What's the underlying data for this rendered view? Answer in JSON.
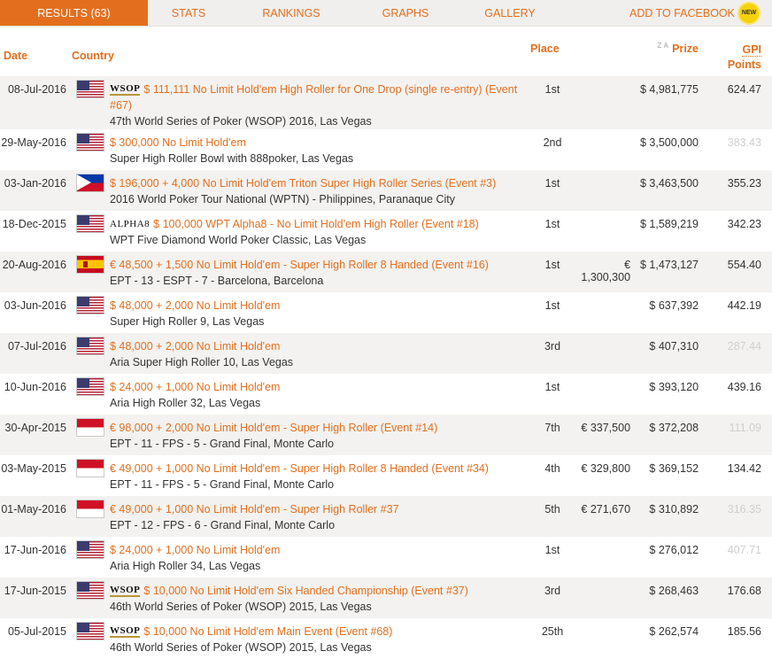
{
  "tabs": [
    {
      "label": "RESULTS (63)",
      "active": true
    },
    {
      "label": "STATS"
    },
    {
      "label": "RANKINGS"
    },
    {
      "label": "GRAPHS"
    },
    {
      "label": "GALLERY"
    },
    {
      "label": "ADD TO FACEBOOK",
      "badge": "NEW"
    }
  ],
  "columns": {
    "date": "Date",
    "country": "Country",
    "place": "Place",
    "prize": "Prize",
    "gpi_line1": "GPI",
    "gpi_line2": "Points",
    "sort_glyph": "Z A"
  },
  "rows": [
    {
      "date": "08-Jul-2016",
      "flag": "us",
      "brand": "WSOP",
      "title": "$ 111,111 No Limit Hold'em High Roller for One Drop (single re-entry) (Event #67)",
      "subtitle": "47th World Series of Poker (WSOP) 2016, Las Vegas",
      "place": "1st",
      "local_prize": "",
      "prize": "$ 4,981,775",
      "gpi": "624.47",
      "gpi_muted": false
    },
    {
      "date": "29-May-2016",
      "flag": "us",
      "brand": "",
      "title": "$ 300,000 No Limit Hold'em",
      "subtitle": "Super High Roller Bowl with 888poker, Las Vegas",
      "place": "2nd",
      "local_prize": "",
      "prize": "$ 3,500,000",
      "gpi": "383.43",
      "gpi_muted": true
    },
    {
      "date": "03-Jan-2016",
      "flag": "ph",
      "brand": "",
      "title": "$ 196,000 + 4,000 No Limit Hold'em Triton Super High Roller Series (Event #3)",
      "subtitle": "2016 World Poker Tour National (WPTN) - Philippines, Paranaque City",
      "place": "1st",
      "local_prize": "",
      "prize": "$ 3,463,500",
      "gpi": "355.23",
      "gpi_muted": false
    },
    {
      "date": "18-Dec-2015",
      "flag": "us",
      "brand": "ALPHA8",
      "title": "$ 100,000 WPT Alpha8 - No Limit Hold'em High Roller (Event #18)",
      "subtitle": "WPT Five Diamond World Poker Classic, Las Vegas",
      "place": "1st",
      "local_prize": "",
      "prize": "$ 1,589,219",
      "gpi": "342.23",
      "gpi_muted": false
    },
    {
      "date": "20-Aug-2016",
      "flag": "es",
      "brand": "",
      "title": "€ 48,500 + 1,500 No Limit Hold'em - Super High Roller 8 Handed (Event #16)",
      "subtitle": "EPT - 13 - ESPT - 7 - Barcelona, Barcelona",
      "place": "1st",
      "local_prize": "€ 1,300,300",
      "prize": "$ 1,473,127",
      "gpi": "554.40",
      "gpi_muted": false
    },
    {
      "date": "03-Jun-2016",
      "flag": "us",
      "brand": "",
      "title": "$ 48,000 + 2,000 No Limit Hold'em",
      "subtitle": "Super High Roller 9, Las Vegas",
      "place": "1st",
      "local_prize": "",
      "prize": "$ 637,392",
      "gpi": "442.19",
      "gpi_muted": false
    },
    {
      "date": "07-Jul-2016",
      "flag": "us",
      "brand": "",
      "title": "$ 48,000 + 2,000 No Limit Hold'em",
      "subtitle": "Aria Super High Roller 10, Las Vegas",
      "place": "3rd",
      "local_prize": "",
      "prize": "$ 407,310",
      "gpi": "287.44",
      "gpi_muted": true
    },
    {
      "date": "10-Jun-2016",
      "flag": "us",
      "brand": "",
      "title": "$ 24,000 + 1,000 No Limit Hold'em",
      "subtitle": "Aria High Roller 32, Las Vegas",
      "place": "1st",
      "local_prize": "",
      "prize": "$ 393,120",
      "gpi": "439.16",
      "gpi_muted": false
    },
    {
      "date": "30-Apr-2015",
      "flag": "mc",
      "brand": "",
      "title": "€ 98,000 + 2,000 No Limit Hold'em - Super High Roller (Event #14)",
      "subtitle": "EPT - 11 - FPS - 5 - Grand Final, Monte Carlo",
      "place": "7th",
      "local_prize": "€ 337,500",
      "prize": "$ 372,208",
      "gpi": "111.09",
      "gpi_muted": true
    },
    {
      "date": "03-May-2015",
      "flag": "mc",
      "brand": "",
      "title": "€ 49,000 + 1,000 No Limit Hold'em - Super High Roller 8 Handed (Event #34)",
      "subtitle": "EPT - 11 - FPS - 5 - Grand Final, Monte Carlo",
      "place": "4th",
      "local_prize": "€ 329,800",
      "prize": "$ 369,152",
      "gpi": "134.42",
      "gpi_muted": false
    },
    {
      "date": "01-May-2016",
      "flag": "mc",
      "brand": "",
      "title": "€ 49,000 + 1,000 No Limit Hold'em - Super High Roller #37",
      "subtitle": "EPT - 12 - FPS - 6 - Grand Final, Monte Carlo",
      "place": "5th",
      "local_prize": "€ 271,670",
      "prize": "$ 310,892",
      "gpi": "316.35",
      "gpi_muted": true
    },
    {
      "date": "17-Jun-2016",
      "flag": "us",
      "brand": "",
      "title": "$ 24,000 + 1,000 No Limit Hold'em",
      "subtitle": "Aria High Roller 34, Las Vegas",
      "place": "1st",
      "local_prize": "",
      "prize": "$ 276,012",
      "gpi": "407.71",
      "gpi_muted": true
    },
    {
      "date": "17-Jun-2015",
      "flag": "us",
      "brand": "WSOP",
      "title": "$ 10,000 No Limit Hold'em Six Handed Championship (Event #37)",
      "subtitle": "46th World Series of Poker (WSOP) 2015, Las Vegas",
      "place": "3rd",
      "local_prize": "",
      "prize": "$ 268,463",
      "gpi": "176.68",
      "gpi_muted": false
    },
    {
      "date": "05-Jul-2015",
      "flag": "us",
      "brand": "WSOP",
      "title": "$ 10,000 No Limit Hold'em Main Event (Event #68)",
      "subtitle": "46th World Series of Poker (WSOP) 2015, Las Vegas",
      "place": "25th",
      "local_prize": "",
      "prize": "$ 262,574",
      "gpi": "185.56",
      "gpi_muted": false
    }
  ]
}
